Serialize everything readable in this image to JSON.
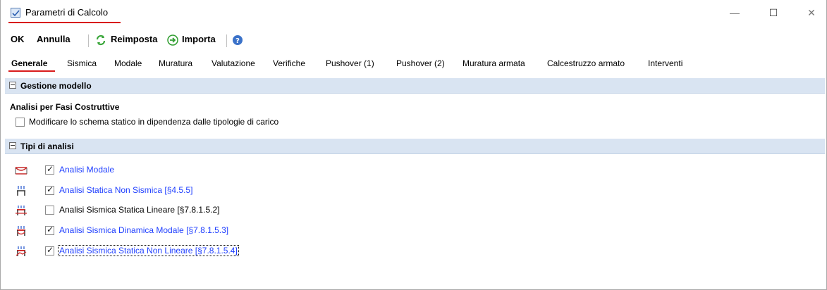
{
  "window": {
    "title": "Parametri di Calcolo",
    "controls": {
      "minimize": "—",
      "maximize": "☐",
      "close": "✕"
    }
  },
  "toolbar": {
    "ok_label": "OK",
    "annulla_label": "Annulla",
    "reimposta_label": "Reimposta",
    "importa_label": "Importa"
  },
  "tabs": [
    {
      "label": "Generale",
      "active": true
    },
    {
      "label": "Sismica"
    },
    {
      "label": "Modale"
    },
    {
      "label": "Muratura"
    },
    {
      "label": "Valutazione"
    },
    {
      "label": "Verifiche"
    },
    {
      "label": "Pushover (1)"
    },
    {
      "label": "Pushover (2)"
    },
    {
      "label": "Muratura armata"
    },
    {
      "label": "Calcestruzzo armato"
    },
    {
      "label": "Interventi"
    }
  ],
  "gestione": {
    "header": "Gestione modello",
    "subheading": "Analisi per Fasi Costruttive",
    "option_label": "Modificare lo schema statico in dipendenza dalle tipologie di carico",
    "option_checked": false
  },
  "tipi": {
    "header": "Tipi di analisi",
    "items": [
      {
        "label": "Analisi Modale",
        "checked": true,
        "icon": "modal-shape-icon"
      },
      {
        "label": "Analisi Statica Non Sismica [§4.5.5]",
        "checked": true,
        "icon": "static-load-icon"
      },
      {
        "label": "Analisi Sismica Statica Lineare [§7.8.1.5.2]",
        "checked": false,
        "icon": "seismic-static-linear-icon"
      },
      {
        "label": "Analisi Sismica Dinamica Modale [§7.8.1.5.3]",
        "checked": true,
        "icon": "seismic-dynamic-modal-icon"
      },
      {
        "label": "Analisi Sismica Statica Non Lineare  [§7.8.1.5.4]",
        "checked": true,
        "icon": "seismic-nonlinear-icon"
      }
    ]
  },
  "colors": {
    "accent_red": "#d81b1b",
    "section_bg": "#d9e4f2",
    "checked_text": "#1f3fff"
  }
}
